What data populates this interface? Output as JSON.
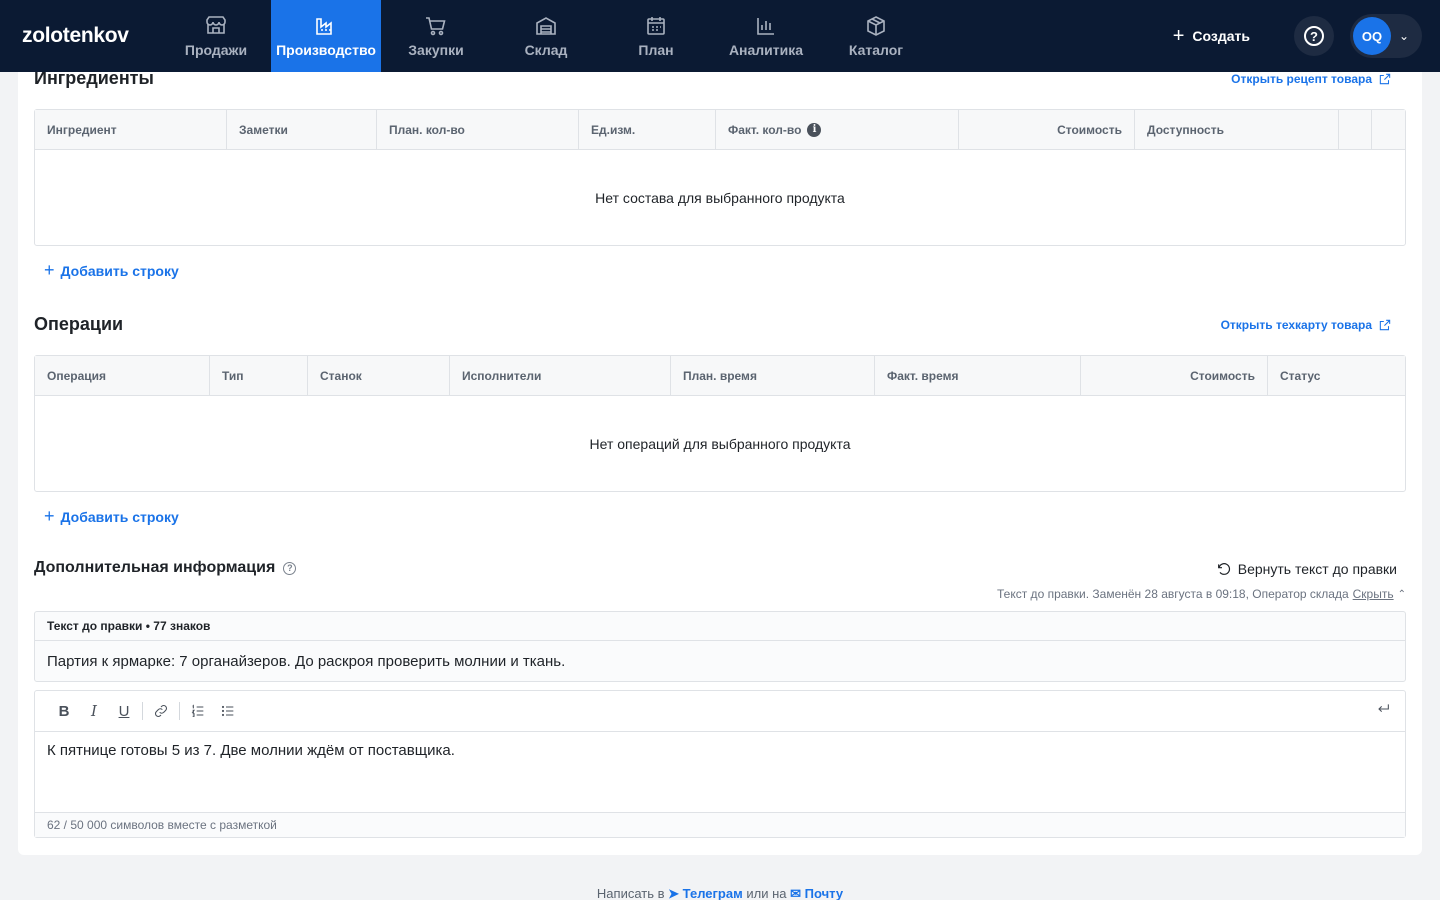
{
  "app": {
    "logo": "zolotenkov"
  },
  "nav": [
    {
      "label": "Продажи",
      "icon": "store-icon"
    },
    {
      "label": "Производство",
      "icon": "factory-icon",
      "active": true
    },
    {
      "label": "Закупки",
      "icon": "cart-icon"
    },
    {
      "label": "Склад",
      "icon": "warehouse-icon"
    },
    {
      "label": "План",
      "icon": "calendar-icon"
    },
    {
      "label": "Аналитика",
      "icon": "chart-icon"
    },
    {
      "label": "Каталог",
      "icon": "box-icon"
    }
  ],
  "header": {
    "create_label": "Создать",
    "help_symbol": "?",
    "avatar_initials": "OQ"
  },
  "ingredients": {
    "title": "Ингредиенты",
    "link": "Открыть рецепт товара",
    "columns": [
      "Ингредиент",
      "Заметки",
      "План. кол-во",
      "Ед.изм.",
      "Факт. кол-во",
      "Стоимость",
      "Доступность"
    ],
    "empty": "Нет состава для выбранного продукта",
    "add_row": "Добавить строку"
  },
  "operations": {
    "title": "Операции",
    "link": "Открыть техкарту товара",
    "columns": [
      "Операция",
      "Тип",
      "Станок",
      "Исполнители",
      "План. время",
      "Факт. время",
      "Стоимость",
      "Статус"
    ],
    "empty": "Нет операций для выбранного продукта",
    "add_row": "Добавить строку"
  },
  "extra": {
    "title": "Дополнительная информация",
    "revert": "Вернуть текст до правки",
    "note": "Текст до правки. Заменён 28 августа в 09:18, Оператор склада",
    "hide": "Скрыть",
    "orig_header": "Текст до правки • 77 знаков",
    "orig_text": "Партия к ярмарке: 7 органайзеров. До раскроя проверить молнии и ткань.",
    "editor_text": "К пятнице готовы 5 из 7. Две молнии ждём от поставщика.",
    "counter": "62 / 50 000 символов вместе с разметкой"
  },
  "footer": {
    "prefix": "Написать в",
    "telegram": "Телеграм",
    "middle": "или на",
    "mail": "Почту"
  },
  "colors": {
    "nav_bg": "#0b1a33",
    "accent": "#1a73e8"
  }
}
